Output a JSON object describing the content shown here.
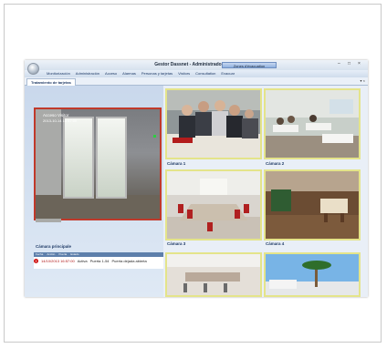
{
  "window": {
    "title": "Gestor Dassnet - Administrador",
    "zones_button": "Zones d'évacuation",
    "controls": [
      "–",
      "□",
      "×"
    ]
  },
  "menu": [
    "Monitorización",
    "Administración",
    "Acceso",
    "Alarmas",
    "Personas y tarjetas",
    "Visitors",
    "Consultation",
    "Evacuar"
  ],
  "tab": {
    "label": "Tratamiento de tarjetas",
    "controls": "▾ ×"
  },
  "main_camera": {
    "overlay_line1": "Acceso Visitor",
    "overlay_line2": "2013-10-14 16:57:00",
    "label": "Cámara principale"
  },
  "events": {
    "headers": [
      "Fecha",
      "Acción",
      "Puerta",
      "Estado"
    ],
    "row": {
      "icon": "alarm-icon",
      "datetime": "14/10/2013 16:57:00",
      "status": "Activa",
      "door": "Puerta 1-54",
      "description": "Puerta dejada abierta"
    }
  },
  "cameras": [
    {
      "label": "Cámara 1"
    },
    {
      "label": "Cámara 2"
    },
    {
      "label": "Cámara 3"
    },
    {
      "label": "Cámara 4"
    }
  ],
  "colors": {
    "accent": "#1f3a66",
    "alarm_red": "#d01818",
    "selected_border": "#c0392b",
    "camera_border": "#e4e48a"
  }
}
